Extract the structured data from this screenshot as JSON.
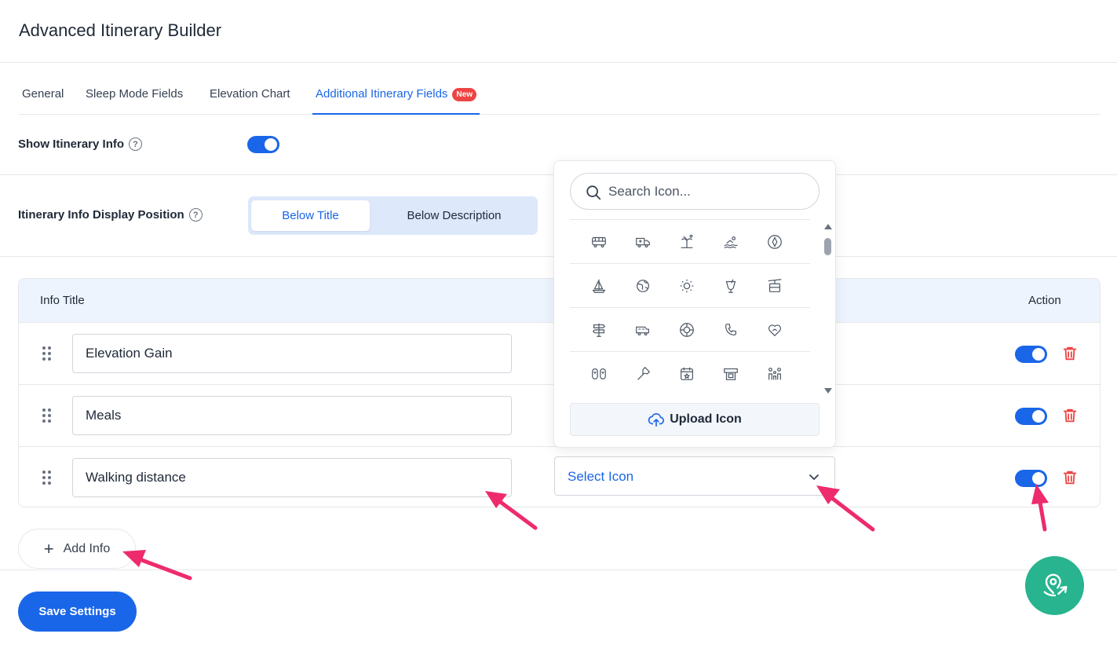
{
  "page": {
    "title": "Advanced Itinerary Builder"
  },
  "tabs": [
    {
      "label": "General"
    },
    {
      "label": "Sleep Mode Fields"
    },
    {
      "label": "Elevation Chart"
    },
    {
      "label": "Additional Itinerary Fields",
      "badge": "New",
      "active": true
    }
  ],
  "show_info": {
    "label": "Show Itinerary Info",
    "enabled": true
  },
  "display_position": {
    "label": "Itinerary Info Display Position",
    "options": [
      "Below Title",
      "Below Description"
    ],
    "selected": "Below Title"
  },
  "table": {
    "headers": {
      "info_title": "Info Title",
      "action": "Action"
    },
    "rows": [
      {
        "title": "Elevation Gain",
        "enabled": true
      },
      {
        "title": "Meals",
        "enabled": true
      },
      {
        "title": "Walking distance",
        "enabled": true,
        "icon_select": "Select Icon"
      }
    ]
  },
  "icon_picker": {
    "search_placeholder": "Search Icon...",
    "icons": [
      [
        "bus-icon",
        "ambulance-icon",
        "palm-island-icon",
        "swimmer-icon",
        "compass-icon"
      ],
      [
        "sailboat-icon",
        "globe-icon",
        "sun-icon",
        "cocktail-icon",
        "cable-car-icon"
      ],
      [
        "signpost-icon",
        "campervan-icon",
        "lifebuoy-icon",
        "phone-icon",
        "heart-hand-icon"
      ],
      [
        "flip-flops-icon",
        "axe-icon",
        "calendar-star-icon",
        "atm-icon",
        "family-icon"
      ]
    ],
    "upload_label": "Upload Icon"
  },
  "add_info_label": "Add Info",
  "save_label": "Save Settings",
  "colors": {
    "primary": "#1a66e8",
    "danger": "#ef4444",
    "fab": "#27b48e",
    "annotation": "#ee2b6c"
  }
}
